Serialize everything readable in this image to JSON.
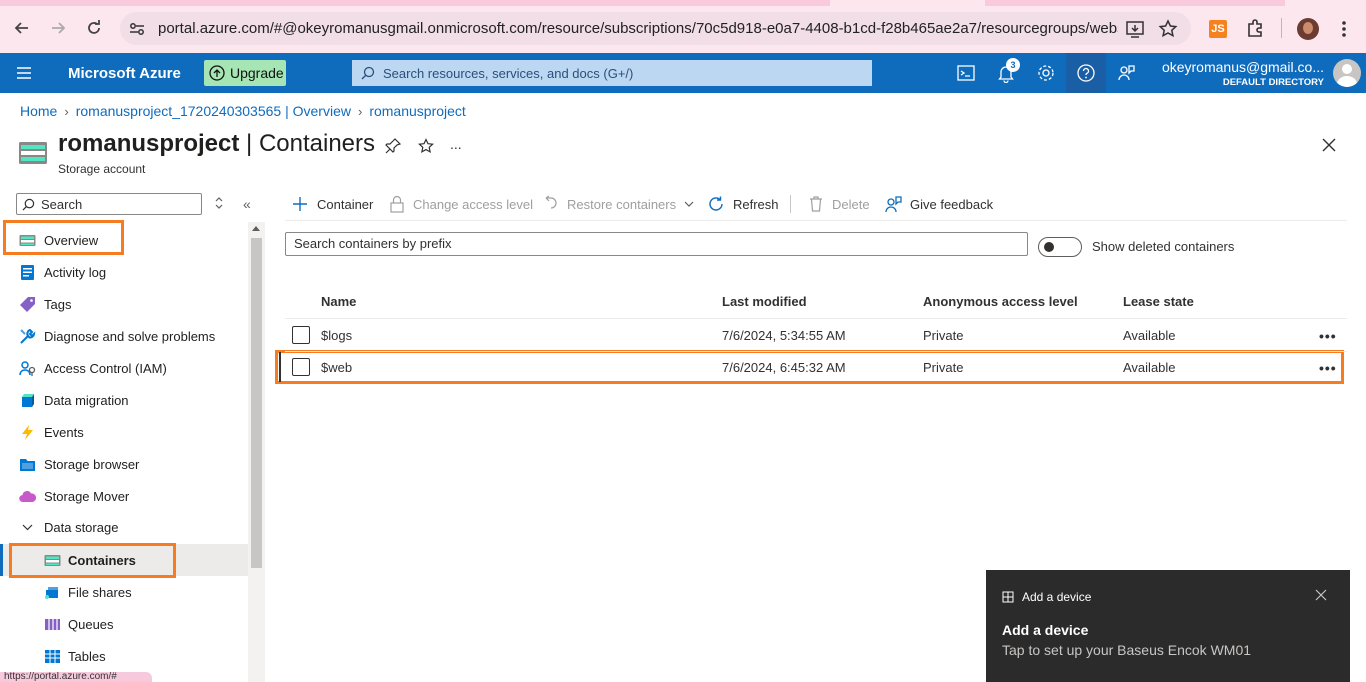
{
  "browser": {
    "url": "portal.azure.com/#@okeyromanusgmail.onmicrosoft.com/resource/subscriptions/70c5d918-e0a7-4408-b1cd-f28b465ae2a7/resourcegroups/websiteRG/p...",
    "js_ext_label": "JS",
    "status_url": "https://portal.azure.com/#"
  },
  "topbar": {
    "brand": "Microsoft Azure",
    "upgrade_label": "Upgrade",
    "search_placeholder": "Search resources, services, and docs (G+/)",
    "notification_count": "3",
    "account_email": "okeyromanus@gmail.co...",
    "account_directory": "DEFAULT DIRECTORY"
  },
  "breadcrumb": [
    "Home",
    "romanusproject_1720240303565 | Overview",
    "romanusproject"
  ],
  "resource": {
    "name": "romanusproject",
    "separator": " | ",
    "section": "Containers",
    "type": "Storage account",
    "more": "..."
  },
  "sidebar": {
    "search_placeholder": "Search",
    "collapse": "«",
    "items": [
      {
        "label": "Overview",
        "icon": "overview-icon"
      },
      {
        "label": "Activity log",
        "icon": "activity-log-icon"
      },
      {
        "label": "Tags",
        "icon": "tag-icon"
      },
      {
        "label": "Diagnose and solve problems",
        "icon": "wrench-icon"
      },
      {
        "label": "Access Control (IAM)",
        "icon": "iam-icon"
      },
      {
        "label": "Data migration",
        "icon": "data-migration-icon"
      },
      {
        "label": "Events",
        "icon": "lightning-icon"
      },
      {
        "label": "Storage browser",
        "icon": "storage-browser-icon"
      },
      {
        "label": "Storage Mover",
        "icon": "cloud-icon"
      },
      {
        "label": "Data storage",
        "icon": "chevron-down-icon"
      },
      {
        "label": "Containers",
        "icon": "containers-icon"
      },
      {
        "label": "File shares",
        "icon": "file-shares-icon"
      },
      {
        "label": "Queues",
        "icon": "queues-icon"
      },
      {
        "label": "Tables",
        "icon": "tables-icon"
      }
    ]
  },
  "commands": {
    "container": "Container",
    "change_access": "Change access level",
    "restore": "Restore containers",
    "refresh": "Refresh",
    "delete": "Delete",
    "feedback": "Give feedback"
  },
  "filter": {
    "placeholder": "Search containers by prefix",
    "toggle_label": "Show deleted containers"
  },
  "table": {
    "headers": [
      "Name",
      "Last modified",
      "Anonymous access level",
      "Lease state"
    ],
    "rows": [
      {
        "name": "$logs",
        "modified": "7/6/2024, 5:34:55 AM",
        "access": "Private",
        "lease": "Available"
      },
      {
        "name": "$web",
        "modified": "7/6/2024, 6:45:32 AM",
        "access": "Private",
        "lease": "Available"
      }
    ],
    "more": "•••"
  },
  "toast": {
    "header": "Add a device",
    "title": "Add a device",
    "body": "Tap to set up your Baseus Encok WM01"
  },
  "colors": {
    "azure_blue": "#0f6cbd",
    "highlight": "#f57c20"
  }
}
